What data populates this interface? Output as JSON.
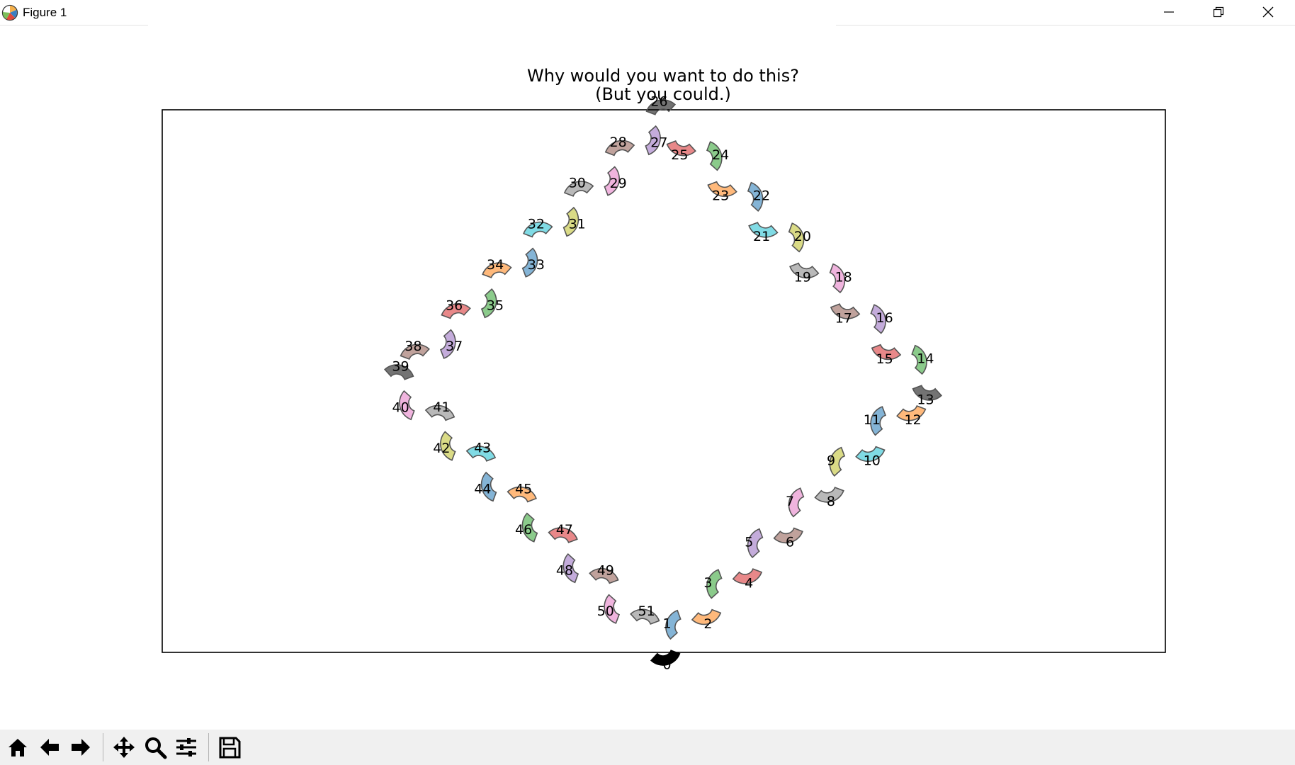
{
  "window": {
    "title": "Figure 1",
    "minimize_icon": "minimize-icon",
    "maximize_icon": "restore-icon",
    "close_icon": "close-icon"
  },
  "figure": {
    "title_line1": "Why would you want to do this?",
    "title_line2": "(But you could.)"
  },
  "chart_data": {
    "type": "scatter",
    "title": "Why would you want to do this?\n(But you could.)",
    "xlabel": "",
    "ylabel": "",
    "axes_ticks": "hidden",
    "grid": false,
    "shape": "closed chain of 52 numbered curved cup-shaped segments arranged along a diamond outline",
    "labels": [
      "0",
      "1",
      "2",
      "3",
      "4",
      "5",
      "6",
      "7",
      "8",
      "9",
      "10",
      "11",
      "12",
      "13",
      "14",
      "15",
      "16",
      "17",
      "18",
      "19",
      "20",
      "21",
      "22",
      "23",
      "24",
      "25",
      "26",
      "27",
      "28",
      "29",
      "30",
      "31",
      "32",
      "33",
      "34",
      "35",
      "36",
      "37",
      "38",
      "39",
      "40",
      "41",
      "42",
      "43",
      "44",
      "45",
      "46",
      "47",
      "48",
      "49",
      "50",
      "51"
    ],
    "segment_colors": [
      "#000000",
      "#1f77b4",
      "#ff7f0e",
      "#2ca02c",
      "#d62728",
      "#9467bd",
      "#8c564b",
      "#e377c2",
      "#7f7f7f",
      "#bcbd22",
      "#17becf",
      "#1f77b4",
      "#ff7f0e",
      "#000000",
      "#2ca02c",
      "#d62728",
      "#9467bd",
      "#8c564b",
      "#e377c2",
      "#7f7f7f",
      "#bcbd22",
      "#17becf",
      "#1f77b4",
      "#ff7f0e",
      "#2ca02c",
      "#d62728",
      "#000000",
      "#9467bd",
      "#8c564b",
      "#e377c2",
      "#7f7f7f",
      "#bcbd22",
      "#17becf",
      "#1f77b4",
      "#ff7f0e",
      "#2ca02c",
      "#d62728",
      "#9467bd",
      "#8c564b",
      "#000000",
      "#e377c2",
      "#7f7f7f",
      "#bcbd22",
      "#17becf",
      "#1f77b4",
      "#ff7f0e",
      "#2ca02c",
      "#d62728",
      "#9467bd",
      "#8c564b",
      "#e377c2",
      "#7f7f7f"
    ]
  },
  "toolbar": {
    "home_icon": "home-icon",
    "back_icon": "back-arrow-icon",
    "forward_icon": "forward-arrow-icon",
    "pan_icon": "pan-icon",
    "zoom_icon": "zoom-icon",
    "configure_icon": "configure-subplots-icon",
    "save_icon": "save-icon"
  }
}
